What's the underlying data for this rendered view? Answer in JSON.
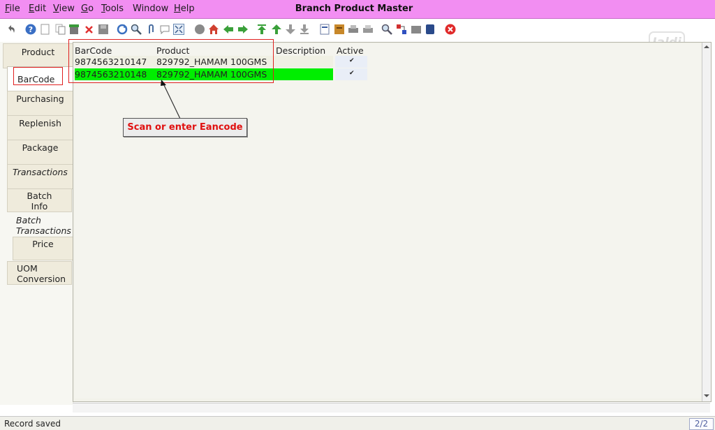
{
  "menu": {
    "items": [
      {
        "first": "F",
        "rest": "ile"
      },
      {
        "first": "E",
        "rest": "dit"
      },
      {
        "first": "V",
        "rest": "iew"
      },
      {
        "first": "G",
        "rest": "o"
      },
      {
        "first": "T",
        "rest": "ools"
      },
      {
        "first": "",
        "rest": "Window"
      },
      {
        "first": "H",
        "rest": "elp"
      }
    ]
  },
  "window": {
    "title": "Branch Product Master"
  },
  "watermark": "Jaldi",
  "toolbar": {
    "icons": [
      "undo-icon",
      "help-icon",
      "new-icon",
      "copy-icon",
      "delete-record-icon",
      "delete-icon",
      "save-icon",
      "refresh-icon",
      "find-icon",
      "attachment-icon",
      "chat-icon",
      "fullscreen-icon",
      "history-icon",
      "home-icon",
      "back-icon",
      "forward-icon",
      "first-icon",
      "previous-icon",
      "next-icon",
      "last-icon",
      "report-icon",
      "archive-icon",
      "print-icon",
      "print-preview-icon",
      "zoom-icon",
      "workflow-icon",
      "request-icon",
      "product-info-icon",
      "exit-icon"
    ]
  },
  "tabs": [
    {
      "label": "Product",
      "line2": ""
    },
    {
      "label": "BarCode",
      "line2": ""
    },
    {
      "label": "Purchasing",
      "line2": ""
    },
    {
      "label": "Replenish",
      "line2": ""
    },
    {
      "label": "Package",
      "line2": ""
    },
    {
      "label": "Transactions",
      "line2": ""
    },
    {
      "label": "Batch",
      "line2": "Info"
    },
    {
      "label": "Batch",
      "line2": "Transactions"
    },
    {
      "label": "Price",
      "line2": ""
    },
    {
      "label": "UOM",
      "line2": "Conversion"
    }
  ],
  "grid": {
    "columns": [
      "BarCode",
      "Product",
      "Description",
      "Active"
    ],
    "rows": [
      {
        "barcode": "9874563210147",
        "product": "829792_HAMAM 100GMS",
        "description": "",
        "active": "✔"
      },
      {
        "barcode": "9874563210148",
        "product": "829792_HAMAM 100GMS",
        "description": "",
        "active": "✔"
      }
    ]
  },
  "callout": {
    "text": "Scan or enter Eancode"
  },
  "status": {
    "message": "Record saved",
    "record_count": "2/2"
  },
  "colors": {
    "menubar": "#f28ef2",
    "selected_row": "#00ee00",
    "annotation": "#e01010"
  }
}
